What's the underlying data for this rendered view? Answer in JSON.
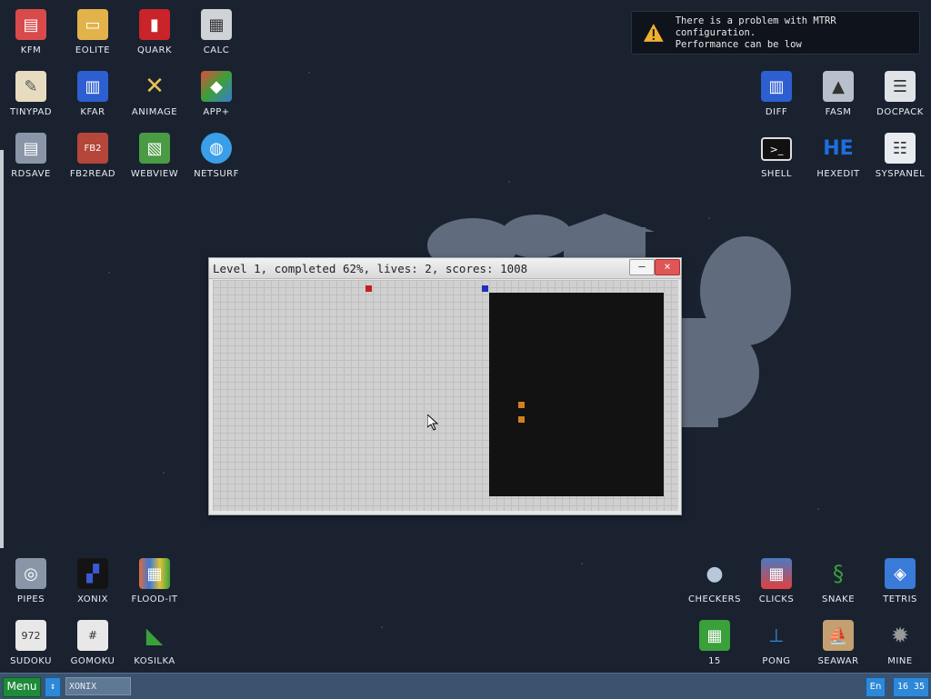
{
  "desktop": {
    "icons_top_left": [
      {
        "label": "KFM",
        "icon": "floppy-icon",
        "color": "#d94a4a"
      },
      {
        "label": "EOLITE",
        "icon": "folder-icon",
        "color": "#e2b34a"
      },
      {
        "label": "QUARK",
        "icon": "book-icon",
        "color": "#c8242a"
      },
      {
        "label": "CALC",
        "icon": "calculator-icon",
        "color": "#cfd3d8"
      },
      {
        "label": "TINYPAD",
        "icon": "notepad-icon",
        "color": "#e7dcbf"
      },
      {
        "label": "KFAR",
        "icon": "panels-icon",
        "color": "#2d5fd0"
      },
      {
        "label": "ANIMAGE",
        "icon": "pencil-ruler-icon",
        "color": "#e7c15a"
      },
      {
        "label": "APP+",
        "icon": "cube-icon",
        "color": "#e34b3b"
      },
      {
        "label": "RDSAVE",
        "icon": "drive-icon",
        "color": "#8a96a8"
      },
      {
        "label": "FB2READ",
        "icon": "fb2-book-icon",
        "color": "#b5463a"
      },
      {
        "label": "WEBVIEW",
        "icon": "map-icon",
        "color": "#4b9a44"
      },
      {
        "label": "NETSURF",
        "icon": "globe-icon",
        "color": "#3a9ee8"
      }
    ],
    "icons_top_right": [
      {
        "label": "DIFF",
        "icon": "diff-icon",
        "color": "#2d5fd0"
      },
      {
        "label": "FASM",
        "icon": "anvil-icon",
        "color": "#b8c0cc"
      },
      {
        "label": "DOCPACK",
        "icon": "cabinet-icon",
        "color": "#dfe3e8"
      },
      {
        "label": "SHELL",
        "icon": "terminal-icon",
        "color": "#111111"
      },
      {
        "label": "HEXEDIT",
        "icon": "hex-icon",
        "color": "#1e6ee0"
      },
      {
        "label": "SYSPANEL",
        "icon": "sliders-icon",
        "color": "#e8ecf0"
      }
    ],
    "icons_bottom_left": [
      {
        "label": "PIPES",
        "icon": "pipes-icon",
        "color": "#8a96a8"
      },
      {
        "label": "XONIX",
        "icon": "xonix-icon",
        "color": "#141414"
      },
      {
        "label": "FLOOD-IT",
        "icon": "flood-grid-icon",
        "color": "#e06a3a"
      },
      {
        "label": "SUDOKU",
        "icon": "sudoku-icon",
        "color": "#e8e8e8"
      },
      {
        "label": "GOMOKU",
        "icon": "tictactoe-icon",
        "color": "#e8e8e8"
      },
      {
        "label": "KOSILKA",
        "icon": "lawnmower-icon",
        "color": "#3aa03a"
      }
    ],
    "icons_bottom_right": [
      {
        "label": "CHECKERS",
        "icon": "checkers-icon",
        "color": "#b8c8dc"
      },
      {
        "label": "CLICKS",
        "icon": "blocks-icon",
        "color": "#4a7ac0"
      },
      {
        "label": "SNAKE",
        "icon": "snake-icon",
        "color": "#3aa03a"
      },
      {
        "label": "TETRIS",
        "icon": "tetris-cube-icon",
        "color": "#3a7ad8"
      },
      {
        "label": "15",
        "icon": "fifteen-grid-icon",
        "color": "#3aa03a"
      },
      {
        "label": "PONG",
        "icon": "pong-icon",
        "color": "#2e88d8"
      },
      {
        "label": "SEAWAR",
        "icon": "ship-icon",
        "color": "#c4a070"
      },
      {
        "label": "MINE",
        "icon": "mine-icon",
        "color": "#7a7a7a"
      }
    ]
  },
  "notification": {
    "line1": "There is a problem with MTRR configuration.",
    "line2": "Performance can be low",
    "icon": "warning-icon",
    "icon_color": "#f0b030"
  },
  "window": {
    "title": "Level 1, completed 62%, lives: 2, scores: 1008",
    "minimize_label": "–",
    "close_label": "×",
    "game": {
      "level": 1,
      "completed_percent": 62,
      "lives": 2,
      "scores": 1008
    }
  },
  "taskbar": {
    "menu_label": "Menu",
    "arrow_label": "↕",
    "task_label": "XONIX",
    "lang_label": "En",
    "clock": "16 35"
  }
}
